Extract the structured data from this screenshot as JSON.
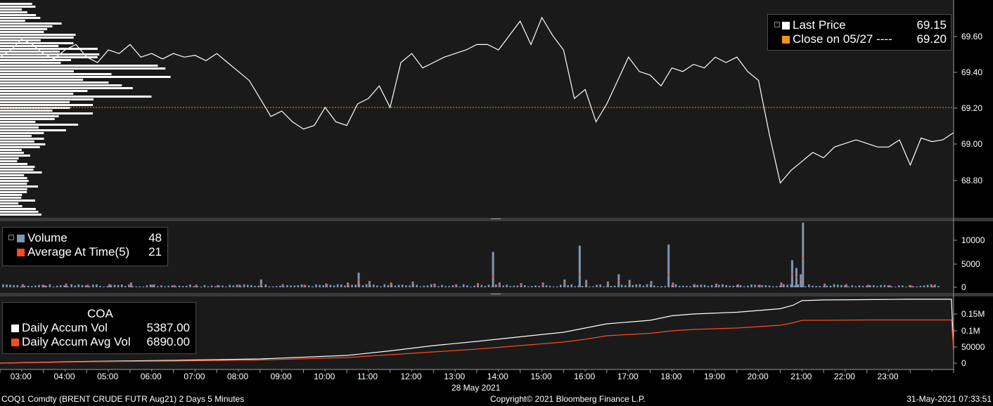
{
  "price_panel": {
    "legend": {
      "last_price_label": "Last Price",
      "last_price_value": "69.15",
      "close_label": "Close on 05/27 ----",
      "close_value": "69.20"
    },
    "y_ticks": [
      "69.60",
      "69.40",
      "69.20",
      "69.00",
      "68.80"
    ],
    "colors": {
      "line": "#ffffff",
      "close_line": "#f4911e",
      "background": "#1a1a1a"
    }
  },
  "volume_panel": {
    "legend": {
      "volume_label": "Volume",
      "volume_value": "48",
      "avg_label": "Average At Time(5)",
      "avg_value": "21"
    },
    "y_ticks": [
      "10000",
      "5000",
      "0"
    ],
    "colors": {
      "volume": "#7f96b5",
      "average": "#ff4a1c"
    }
  },
  "accum_panel": {
    "legend": {
      "title": "COA",
      "accum_label": "Daily Accum Vol",
      "accum_value": "5387.00",
      "avg_label": "Daily Accum Avg Vol",
      "avg_value": "6890.00"
    },
    "y_ticks": [
      "0.15M",
      "0.1M",
      "50000",
      "0"
    ],
    "colors": {
      "accum": "#ffffff",
      "avg": "#ff4a1c"
    }
  },
  "x_axis": {
    "ticks": [
      "03:00",
      "04:00",
      "05:00",
      "06:00",
      "07:00",
      "08:00",
      "09:00",
      "10:00",
      "11:00",
      "12:00",
      "13:00",
      "14:00",
      "15:00",
      "16:00",
      "17:00",
      "18:00",
      "19:00",
      "20:00",
      "21:00",
      "22:00",
      "23:00"
    ],
    "date_label": "28 May 2021"
  },
  "footer": {
    "left": "COQ1 Comdty (BRENT CRUDE FUTR  Aug21) 2 Days 5 Minutes",
    "center": "Copyright© 2021 Bloomberg Finance L.P.",
    "right": "31-May-2021 07:33:51"
  },
  "chart_data": [
    {
      "type": "line",
      "title": "Last Price",
      "x_unit": "hour of day (28 May 2021)",
      "x": [
        2.0,
        2.25,
        2.5,
        2.75,
        3.0,
        3.25,
        3.5,
        3.75,
        4.0,
        4.25,
        4.5,
        4.75,
        5.0,
        5.25,
        5.5,
        5.75,
        6.0,
        6.25,
        6.5,
        6.75,
        7.0,
        7.25,
        7.5,
        7.75,
        8.0,
        8.25,
        8.5,
        8.75,
        9.0,
        9.25,
        9.5,
        9.75,
        10.0,
        10.25,
        10.5,
        10.75,
        11.0,
        11.25,
        11.5,
        11.75,
        12.0,
        12.25,
        12.5,
        12.75,
        13.0,
        13.25,
        13.5,
        13.75,
        14.0,
        14.25,
        14.5,
        14.75,
        15.0,
        15.25,
        15.5,
        15.75,
        16.0,
        16.25,
        16.5,
        16.75,
        17.0,
        17.25,
        17.5,
        17.75,
        18.0,
        18.25,
        18.5,
        18.75,
        19.0,
        19.25,
        19.5,
        19.75,
        20.0,
        20.25,
        20.5,
        20.75,
        21.0,
        21.25,
        21.5,
        21.75,
        22.0,
        22.25,
        22.5,
        22.75,
        23.0,
        23.25,
        23.5,
        23.75,
        24.0
      ],
      "y": [
        69.48,
        69.52,
        69.58,
        69.55,
        69.5,
        69.47,
        69.52,
        69.55,
        69.48,
        69.45,
        69.52,
        69.5,
        69.55,
        69.48,
        69.5,
        69.47,
        69.5,
        69.48,
        69.49,
        69.46,
        69.5,
        69.45,
        69.4,
        69.35,
        69.25,
        69.15,
        69.18,
        69.12,
        69.08,
        69.1,
        69.2,
        69.12,
        69.1,
        69.22,
        69.25,
        69.32,
        69.2,
        69.45,
        69.5,
        69.42,
        69.45,
        69.48,
        69.5,
        69.52,
        69.55,
        69.55,
        69.52,
        69.6,
        69.68,
        69.55,
        69.7,
        69.6,
        69.52,
        69.25,
        69.3,
        69.12,
        69.22,
        69.35,
        69.48,
        69.4,
        69.38,
        69.32,
        69.42,
        69.4,
        69.44,
        69.42,
        69.48,
        69.45,
        69.48,
        69.4,
        69.35,
        69.05,
        68.78,
        68.85,
        68.9,
        68.95,
        68.92,
        68.98,
        69.0,
        69.02,
        69.0,
        68.98,
        68.98,
        69.02,
        68.88,
        69.03,
        69.01,
        69.02,
        69.06
      ]
    },
    {
      "type": "line",
      "title": "Close on 05/27",
      "y": [
        69.2
      ]
    },
    {
      "type": "bar",
      "title": "Volume",
      "x_unit": "hour of day (28 May 2021)",
      "ylim": [
        0,
        12000
      ],
      "x": [
        2.5,
        3.0,
        3.5,
        4.0,
        4.5,
        5.0,
        5.5,
        6.0,
        6.5,
        7.0,
        7.5,
        8.0,
        8.5,
        9.0,
        9.5,
        10.0,
        10.25,
        10.5,
        11.0,
        11.5,
        12.0,
        12.5,
        13.0,
        13.35,
        13.5,
        14.0,
        14.5,
        15.0,
        15.35,
        15.5,
        16.0,
        16.25,
        16.5,
        17.0,
        17.4,
        17.5,
        18.0,
        18.5,
        19.0,
        19.5,
        20.0,
        20.25,
        20.35,
        20.45,
        20.5,
        21.0,
        21.5,
        22.0,
        22.5,
        23.0,
        23.5
      ],
      "series": [
        {
          "name": "Volume",
          "values": [
            600,
            400,
            700,
            500,
            600,
            900,
            500,
            400,
            500,
            400,
            500,
            1500,
            600,
            500,
            700,
            900,
            2800,
            1200,
            900,
            1100,
            700,
            600,
            800,
            6800,
            900,
            800,
            900,
            1500,
            8000,
            1400,
            1100,
            2500,
            1400,
            1200,
            8200,
            900,
            600,
            700,
            600,
            500,
            900,
            5200,
            3700,
            2500,
            12400,
            700,
            600,
            500,
            400,
            300,
            200
          ]
        },
        {
          "name": "Average At Time(5)",
          "values": [
            300,
            300,
            400,
            300,
            400,
            500,
            300,
            300,
            300,
            300,
            300,
            600,
            400,
            300,
            400,
            500,
            1400,
            700,
            600,
            700,
            400,
            400,
            500,
            2000,
            500,
            500,
            500,
            800,
            2500,
            800,
            700,
            1200,
            800,
            700,
            2400,
            500,
            400,
            400,
            400,
            300,
            500,
            2600,
            1900,
            1400,
            5500,
            400,
            400,
            300,
            300,
            200,
            100
          ]
        }
      ]
    },
    {
      "type": "line",
      "title": "COA",
      "x_unit": "hour of day (28 May 2021)",
      "ylim": [
        0,
        170000
      ],
      "x": [
        2.0,
        4.0,
        6.0,
        8.0,
        10.0,
        11.0,
        12.0,
        13.0,
        14.0,
        15.0,
        15.5,
        16.0,
        17.0,
        17.5,
        18.0,
        19.0,
        20.0,
        20.3,
        20.5,
        21.0,
        22.0,
        23.0,
        23.95,
        24.0
      ],
      "series": [
        {
          "name": "Daily Accum Vol",
          "values": [
            0,
            5000,
            8000,
            12000,
            22000,
            35000,
            50000,
            62000,
            75000,
            88000,
            100000,
            112000,
            122000,
            135000,
            140000,
            145000,
            155000,
            165000,
            178000,
            180000,
            181000,
            182000,
            182000,
            40000
          ]
        },
        {
          "name": "Daily Accum Avg Vol",
          "values": [
            0,
            4000,
            6000,
            9000,
            16000,
            24000,
            32000,
            40000,
            50000,
            60000,
            68000,
            78000,
            85000,
            92000,
            96000,
            100000,
            108000,
            115000,
            122000,
            122000,
            123000,
            123000,
            123000,
            36000
          ]
        }
      ]
    }
  ]
}
